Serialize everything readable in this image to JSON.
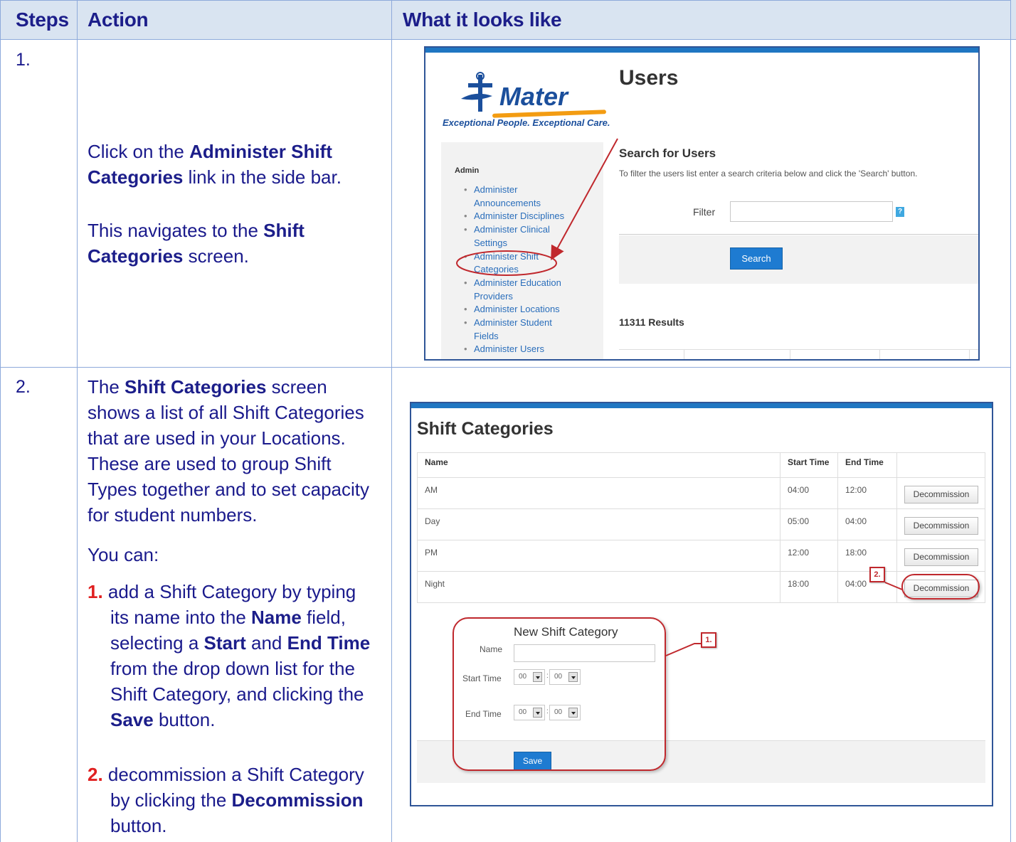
{
  "header": {
    "col_steps": "Steps",
    "col_action": "Action",
    "col_looks": "What it looks like"
  },
  "step1": {
    "number": "1.",
    "line1_pre": "Click on the ",
    "line1_bold": "Administer Shift Categories",
    "line1_post": " link in the side bar.",
    "line2_pre": "This navigates to the ",
    "line2_bold": "Shift Categories",
    "line2_post": " screen."
  },
  "step2": {
    "number": "2.",
    "p1_pre": "The ",
    "p1_bold": "Shift Categories",
    "p1_post": " screen shows a list of all Shift Categories that are used in your Locations. These are used to group Shift Types together and to set capacity for student numbers.",
    "you_can": "You can:",
    "item1_num": "1.",
    "item1_a": " add a Shift Category by typing its name into the  ",
    "item1_b": "Name",
    "item1_c": " field, selecting a ",
    "item1_d": "Start",
    "item1_e": " and ",
    "item1_f": "End Time",
    "item1_g": " from the drop down list for the Shift Category, and clicking the ",
    "item1_h": "Save",
    "item1_i": " button.",
    "item2_num": "2.",
    "item2_a": " decommission a Shift Category by clicking the ",
    "item2_b": "Decommission",
    "item2_c": " button."
  },
  "shot1": {
    "logo_word": "Mater",
    "logo_tagline": "Exceptional People. Exceptional Care.",
    "page_title": "Users",
    "sidebar_heading": "Admin",
    "sidebar_links": [
      "Administer Announcements",
      "Administer Disciplines",
      "Administer Clinical Settings",
      "Administer Shift Categories",
      "Administer Education Providers",
      "Administer Locations",
      "Administer Student Fields",
      "Administer Users"
    ],
    "search_title": "Search for Users",
    "search_desc": "To filter the users list enter a search criteria below and click the 'Search' button.",
    "filter_label": "Filter",
    "filter_value": "",
    "help_icon": "?",
    "search_button": "Search",
    "results_text": "11311 Results"
  },
  "shot2": {
    "title": "Shift Categories",
    "columns": [
      "Name",
      "Start Time",
      "End Time",
      ""
    ],
    "rows": [
      {
        "name": "AM",
        "start": "04:00",
        "end": "12:00",
        "action": "Decommission"
      },
      {
        "name": "Day",
        "start": "05:00",
        "end": "04:00",
        "action": "Decommission"
      },
      {
        "name": "PM",
        "start": "12:00",
        "end": "18:00",
        "action": "Decommission"
      },
      {
        "name": "Night",
        "start": "18:00",
        "end": "04:00",
        "action": "Decommission"
      }
    ],
    "new_title": "New Shift Category",
    "name_label": "Name",
    "name_value": "",
    "start_label": "Start Time",
    "end_label": "End Time",
    "start_hour": "00",
    "start_min": "00",
    "end_hour": "00",
    "end_min": "00",
    "time_separator": ":",
    "save_button": "Save",
    "callout1": "1.",
    "callout2": "2."
  },
  "colors": {
    "text_blue": "#1a1a8c",
    "header_fill": "#d9e4f1",
    "border": "#8eaadb",
    "link_blue": "#2a6ebb",
    "button_blue": "#1e7bd1",
    "annotation_red": "#c0282d",
    "step_red": "#e02020"
  }
}
